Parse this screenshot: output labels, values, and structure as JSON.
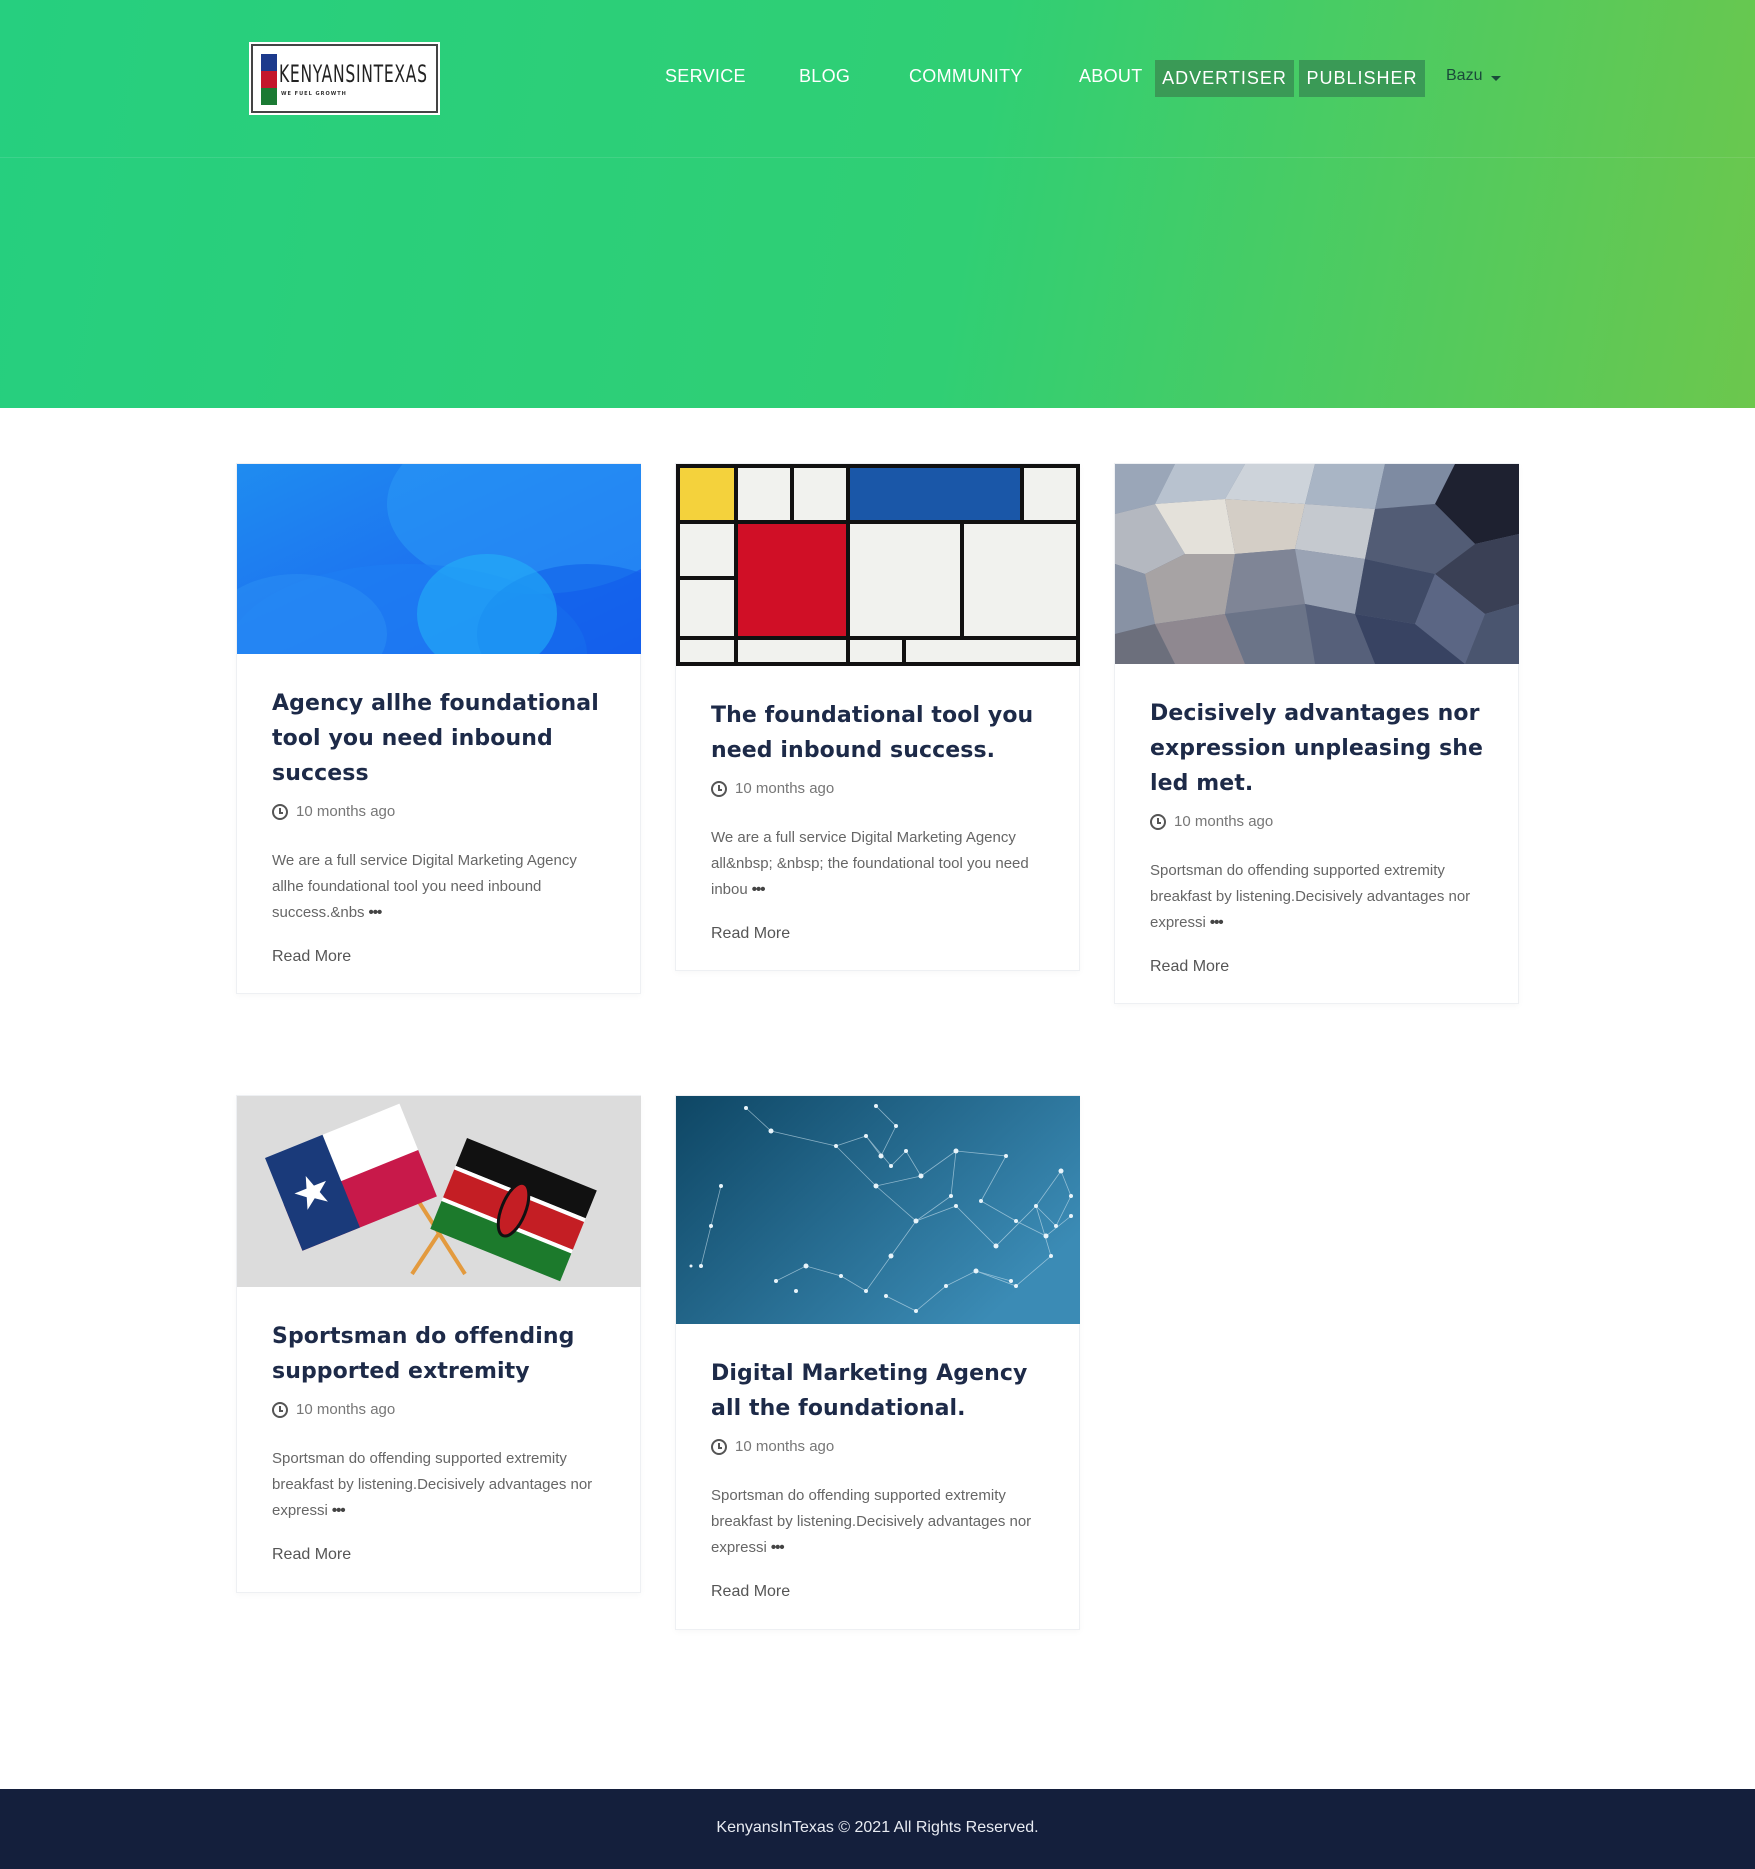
{
  "header": {
    "logo_text": "KENYANSINTEXAS",
    "logo_tagline": "WE FUEL GROWTH",
    "nav": {
      "service": "SERVICE",
      "blog": "BLOG",
      "community": "COMMUNITY",
      "about": "ABOUT",
      "advertiser": "ADVERTISER",
      "publisher": "PUBLISHER"
    },
    "language": "Bazu"
  },
  "posts": [
    {
      "title": "Agency allhe foundational tool you need inbound success",
      "time": "10 months ago",
      "excerpt": "We are a full service Digital Marketing Agency allhe foundational tool you need inbound success.&nbs",
      "read_more": "Read More",
      "image": "blue-abstract-waves"
    },
    {
      "title": "The foundational tool you need inbound success.",
      "time": "10 months ago",
      "excerpt": "We are a full service Digital Marketing Agency all&nbsp; &nbsp; the foundational tool you need inbou",
      "read_more": "Read More",
      "image": "mondrian-grid"
    },
    {
      "title": "Decisively advantages nor expression unpleasing she led met.",
      "time": "10 months ago",
      "excerpt": "Sportsman do offending supported extremity breakfast by listening.Decisively advantages nor expressi",
      "read_more": "Read More",
      "image": "grey-polygons"
    },
    {
      "title": "Sportsman do offending supported extremity",
      "time": "10 months ago",
      "excerpt": "Sportsman do offending supported extremity breakfast by listening.Decisively advantages nor expressi",
      "read_more": "Read More",
      "image": "texas-kenya-flags"
    },
    {
      "title": "Digital Marketing Agency all the foundational.",
      "time": "10 months ago",
      "excerpt": "Sportsman do offending supported extremity breakfast by listening.Decisively advantages nor expressi",
      "read_more": "Read More",
      "image": "network-constellation"
    }
  ],
  "footer": {
    "text": "KenyansInTexas © 2021 All Rights Reserved."
  },
  "colors": {
    "hero_start": "#26cf7f",
    "hero_end": "#6cc74d",
    "nav_button": "#3a9a56",
    "footer_bg": "#141f3c",
    "title_text": "#1d2a48"
  }
}
